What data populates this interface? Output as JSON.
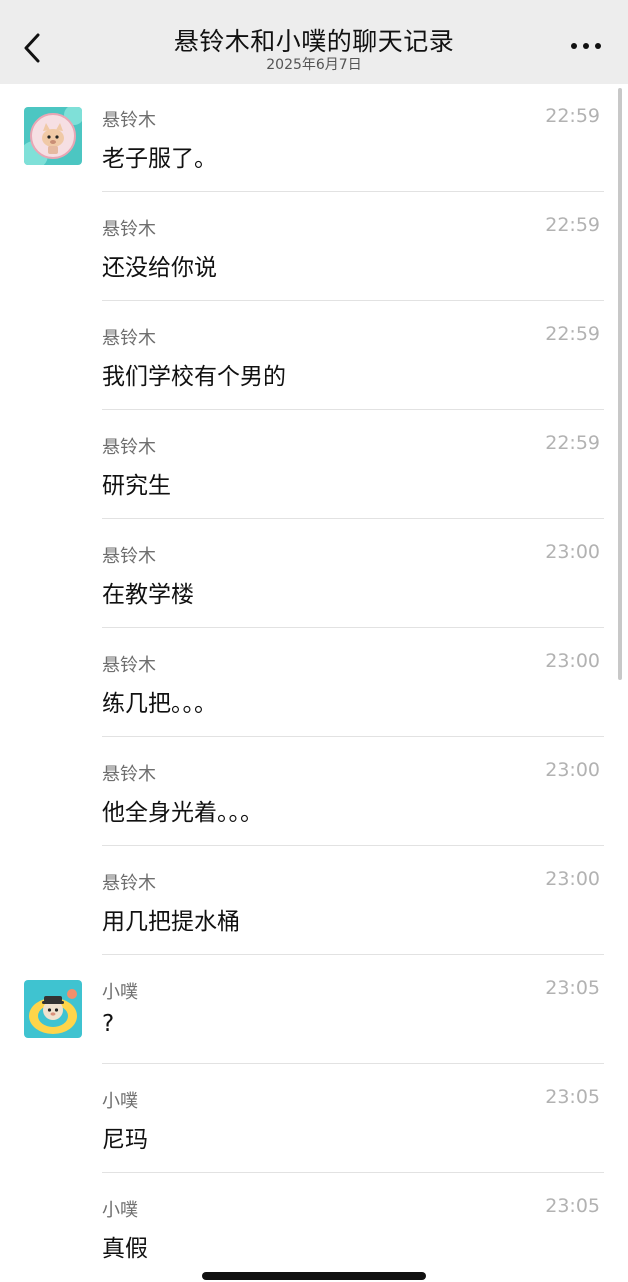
{
  "header": {
    "title": "悬铃木和小噗的聊天记录",
    "date": "2025年6月7日"
  },
  "messages": [
    {
      "sender": "悬铃木",
      "time": "22:59",
      "text": "老子服了。"
    },
    {
      "sender": "悬铃木",
      "time": "22:59",
      "text": "还没给你说"
    },
    {
      "sender": "悬铃木",
      "time": "22:59",
      "text": "我们学校有个男的"
    },
    {
      "sender": "悬铃木",
      "time": "22:59",
      "text": "研究生"
    },
    {
      "sender": "悬铃木",
      "time": "23:00",
      "text": "在教学楼"
    },
    {
      "sender": "悬铃木",
      "time": "23:00",
      "text": "练几把。。。"
    },
    {
      "sender": "悬铃木",
      "time": "23:00",
      "text": "他全身光着。。。"
    },
    {
      "sender": "悬铃木",
      "time": "23:00",
      "text": "用几把提水桶"
    },
    {
      "sender": "小噗",
      "time": "23:05",
      "text": "?"
    },
    {
      "sender": "小噗",
      "time": "23:05",
      "text": "尼玛"
    },
    {
      "sender": "小噗",
      "time": "23:05",
      "text": "真假"
    }
  ],
  "icons": {
    "back": "chevron-left-icon",
    "more": "more-dots-icon"
  },
  "colors": {
    "header_bg": "#ededed",
    "sender": "#6f6f6f",
    "time": "#b2b2b2",
    "divider": "#e2e2e2"
  }
}
